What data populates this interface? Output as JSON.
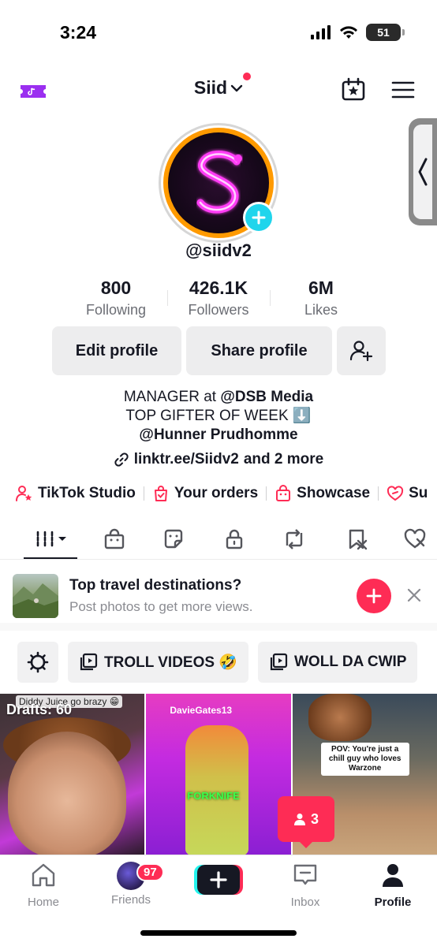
{
  "status_bar": {
    "time": "3:24",
    "battery": "51"
  },
  "top_nav": {
    "username": "Siid"
  },
  "profile": {
    "handle": "@siidv2",
    "stats": [
      {
        "value": "800",
        "label": "Following"
      },
      {
        "value": "426.1K",
        "label": "Followers"
      },
      {
        "value": "6M",
        "label": "Likes"
      }
    ],
    "buttons": {
      "edit": "Edit profile",
      "share": "Share profile"
    },
    "bio": {
      "line1_prefix": "MANAGER at ",
      "line1_mention": "@DSB Media",
      "line2": "TOP GIFTER OF WEEK ⬇️",
      "line3": "@Hunner Prudhomme"
    },
    "link": {
      "url": "linktr.ee/Siidv2",
      "more": "and 2 more"
    }
  },
  "shortcuts": [
    {
      "label": "TikTok Studio",
      "icon": "person-star-icon"
    },
    {
      "label": "Your orders",
      "icon": "shopping-bag-icon"
    },
    {
      "label": "Showcase",
      "icon": "shop-icon"
    },
    {
      "label": "Su",
      "icon": "subscription-icon"
    }
  ],
  "tabs": [
    "grid-videos-icon",
    "shop-icon",
    "sticker-icon",
    "lock-icon",
    "repost-icon",
    "favorites-icon",
    "liked-icon"
  ],
  "promo": {
    "title": "Top travel destinations?",
    "subtitle": "Post photos to get more views."
  },
  "playlists": [
    {
      "label": "TROLL VIDEOS 🤣"
    },
    {
      "label": "WOLL DA CWIP"
    }
  ],
  "grid": {
    "drafts": "Drafts: 60",
    "cell1_caption": "Diddy Juice go brazy 😁",
    "cell2_user": "DavieGates13",
    "cell2_caption": "FORKNIFE",
    "cell3_caption": "POV: You're just a chill guy who loves Warzone",
    "views_badge": "3"
  },
  "bottom_nav": {
    "home": "Home",
    "friends": "Friends",
    "friends_badge": "97",
    "inbox": "Inbox",
    "profile": "Profile"
  },
  "colors": {
    "accent": "#fe2c55",
    "teal": "#20d5ec",
    "text": "#161823"
  }
}
